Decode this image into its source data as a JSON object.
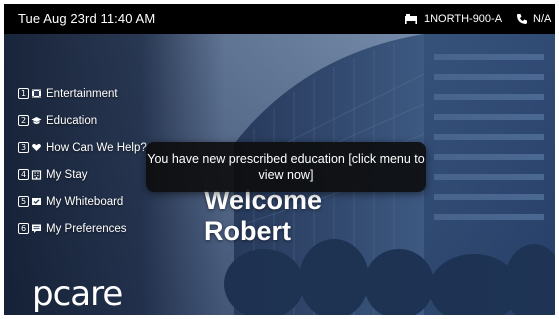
{
  "status_bar": {
    "datetime": "Tue Aug 23rd 11:40 AM",
    "room": "1NORTH-900-A",
    "phone": "N/A",
    "room_icon": "bed-icon",
    "phone_icon": "phone-icon"
  },
  "menu": {
    "items": [
      {
        "number": "1",
        "label": "Entertainment",
        "icon": "film-icon"
      },
      {
        "number": "2",
        "label": "Education",
        "icon": "graduation-cap-icon"
      },
      {
        "number": "3",
        "label": "How Can We Help?",
        "icon": "heart-hands-icon"
      },
      {
        "number": "4",
        "label": "My Stay",
        "icon": "hospital-building-icon"
      },
      {
        "number": "5",
        "label": "My Whiteboard",
        "icon": "check-board-icon"
      },
      {
        "number": "6",
        "label": "My Preferences",
        "icon": "chat-icon"
      }
    ]
  },
  "welcome": {
    "line1": "Welcome",
    "line2": "Robert"
  },
  "notification": {
    "message": "You have new prescribed education [click menu to view now]"
  },
  "logo": {
    "text": "pcare"
  },
  "colors": {
    "topbar": "#000000",
    "background": "#1c2d4a",
    "text": "#ffffff"
  }
}
